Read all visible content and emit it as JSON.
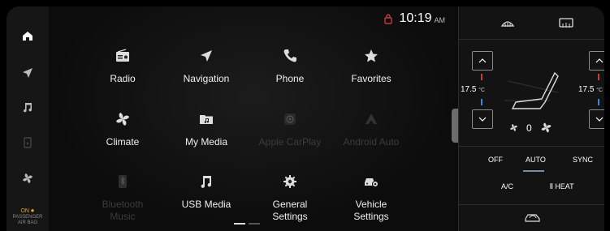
{
  "status": {
    "time": "10:19",
    "ampm": "AM"
  },
  "rail": {
    "airbag_on": "ON",
    "airbag_line1": "PASSENGER",
    "airbag_line2": "AIR BAG"
  },
  "apps": [
    {
      "label": "Radio",
      "icon": "radio-icon",
      "enabled": true
    },
    {
      "label": "Navigation",
      "icon": "navigation-icon",
      "enabled": true
    },
    {
      "label": "Phone",
      "icon": "phone-icon",
      "enabled": true
    },
    {
      "label": "Favorites",
      "icon": "star-icon",
      "enabled": true
    },
    {
      "label": "Climate",
      "icon": "fan-icon",
      "enabled": true
    },
    {
      "label": "My Media",
      "icon": "media-folder-icon",
      "enabled": true
    },
    {
      "label": "Apple CarPlay",
      "icon": "carplay-icon",
      "enabled": false
    },
    {
      "label": "Android Auto",
      "icon": "android-auto-icon",
      "enabled": false
    },
    {
      "label": "Bluetooth\nMusic",
      "icon": "bluetooth-music-icon",
      "enabled": false
    },
    {
      "label": "USB Media",
      "icon": "music-note-icon",
      "enabled": true
    },
    {
      "label": "General\nSettings",
      "icon": "gear-icon",
      "enabled": true
    },
    {
      "label": "Vehicle\nSettings",
      "icon": "car-settings-icon",
      "enabled": true
    }
  ],
  "climate": {
    "left_temp": "17.5",
    "right_temp": "17.5",
    "temp_unit": "°C",
    "fan_speed": "0",
    "off_label": "OFF",
    "auto_label": "AUTO",
    "sync_label": "SYNC",
    "ac_label": "A/C",
    "heat_label": "HEAT",
    "colors": {
      "hot": "#d23a3a",
      "cold": "#3a86d2",
      "accent": "#6f8fa8"
    }
  }
}
